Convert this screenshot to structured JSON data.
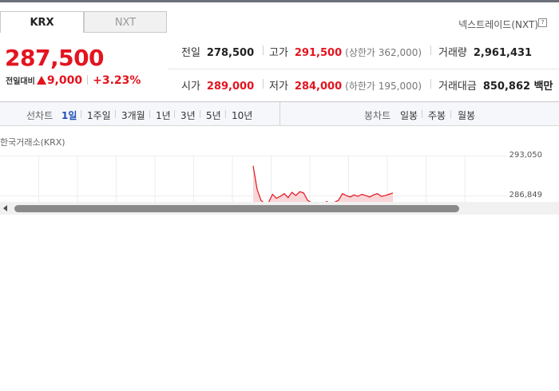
{
  "tabs": {
    "krx": "KRX",
    "nxt": "NXT"
  },
  "nxt_link": "넥스트레이드(NXT)",
  "help_icon": "?",
  "price": "287,500",
  "change": {
    "label": "전일대비",
    "amount": "9,000",
    "percent": "+3.23%",
    "direction": "up"
  },
  "info": {
    "prev_close": {
      "label": "전일",
      "value": "278,500"
    },
    "high": {
      "label": "고가",
      "value": "291,500",
      "limit": "(상한가 362,000)"
    },
    "volume": {
      "label": "거래량",
      "value": "2,961,431"
    },
    "open": {
      "label": "시가",
      "value": "289,000"
    },
    "low": {
      "label": "저가",
      "value": "284,000",
      "limit": "(하한가 195,000)"
    },
    "trade_value": {
      "label": "거래대금",
      "value": "850,862 백만"
    }
  },
  "toolbar": {
    "line_chart_label": "선차트",
    "periods": [
      "1일",
      "1주일",
      "3개월",
      "1년",
      "3년",
      "5년",
      "10년"
    ],
    "active_period": "1일",
    "candle_label": "봉차트",
    "candle_periods": [
      "일봉",
      "주봉",
      "월봉"
    ]
  },
  "chart_title": "한국거래소(KRX)",
  "chart_data": {
    "type": "area",
    "title": "한국거래소(KRX)",
    "y_tick_labels": [
      "293,050",
      "286,849"
    ],
    "ylim": [
      284000,
      293050
    ],
    "series": [
      {
        "values": [
          291500,
          288000,
          286300,
          285800,
          286000,
          287200,
          286600,
          286900,
          287300,
          286700,
          287500,
          287000,
          287600,
          287400,
          286300,
          285900,
          286000,
          285600,
          285800,
          286100,
          285700,
          286000,
          286300,
          287300,
          287000,
          286800,
          287100,
          286900,
          287200,
          287000,
          286800,
          287100,
          287300,
          286900,
          287000,
          287200,
          287400
        ]
      }
    ],
    "colors": {
      "line": "#e3141f",
      "fill": "#f9d6d8"
    },
    "grid": true
  }
}
